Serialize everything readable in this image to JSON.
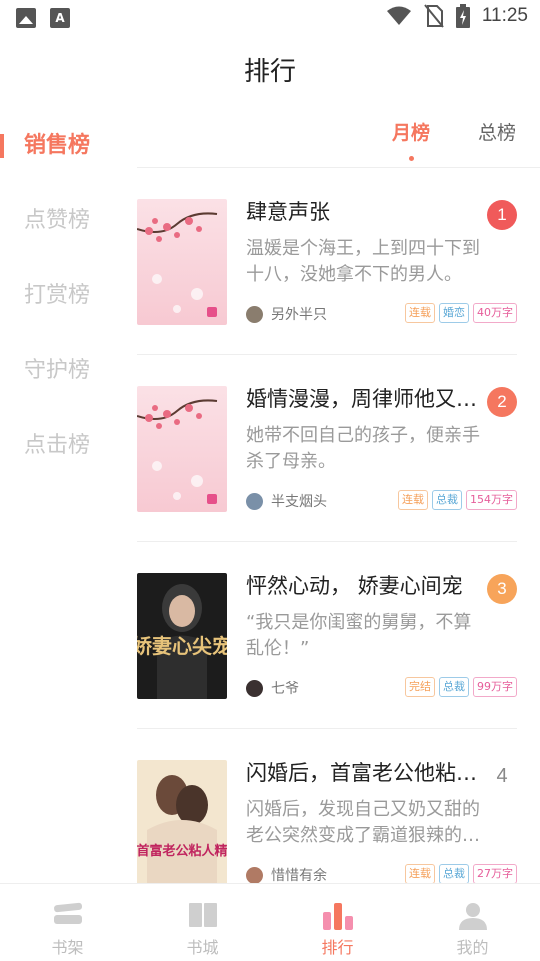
{
  "status": {
    "time": "11:25"
  },
  "header": {
    "title": "排行"
  },
  "sidenav": [
    {
      "label": "销售榜",
      "active": true
    },
    {
      "label": "点赞榜"
    },
    {
      "label": "打赏榜"
    },
    {
      "label": "守护榜"
    },
    {
      "label": "点击榜"
    }
  ],
  "tabs": [
    {
      "label": "月榜",
      "active": true
    },
    {
      "label": "总榜"
    }
  ],
  "books": [
    {
      "rank": "1",
      "title": "肆意声张",
      "desc": "温媛是个海王，上到四十下到十八，没她拿不下的男人。",
      "author": "另外半只",
      "tags": [
        "连载",
        "婚恋",
        "40万字"
      ],
      "rank_color": "#f05a5a"
    },
    {
      "rank": "2",
      "title": "婚情漫漫，周律师他又心动了",
      "desc": "她带不回自己的孩子，便亲手杀了母亲。",
      "author": "半支烟头",
      "tags": [
        "连载",
        "总裁",
        "154万字"
      ],
      "rank_color": "#f5775f"
    },
    {
      "rank": "3",
      "title": "怦然心动， 娇妻心间宠",
      "desc": "“我只是你闺蜜的舅舅，不算乱伦！”",
      "author": "七爷",
      "tags": [
        "完结",
        "总裁",
        "99万字"
      ],
      "rank_color": "#f7a45a"
    },
    {
      "rank": "4",
      "title": "闪婚后，首富老公他粘人精",
      "desc": "闪婚后，发现自己又奶又甜的老公突然变成了霸道狠辣的首富",
      "author": "惜惜有余",
      "tags": [
        "连载",
        "总裁",
        "27万字"
      ],
      "rank_color": ""
    }
  ],
  "bottomnav": [
    {
      "label": "书架",
      "icon": "bookshelf-icon"
    },
    {
      "label": "书城",
      "icon": "book-icon"
    },
    {
      "label": "排行",
      "icon": "ranking-icon",
      "active": true
    },
    {
      "label": "我的",
      "icon": "user-icon"
    }
  ],
  "colors": {
    "accent": "#f5775f"
  },
  "covers": {
    "book3": {
      "title": "娇妻心尖宠"
    },
    "book4": {
      "title": "首富老公粘人精"
    }
  }
}
